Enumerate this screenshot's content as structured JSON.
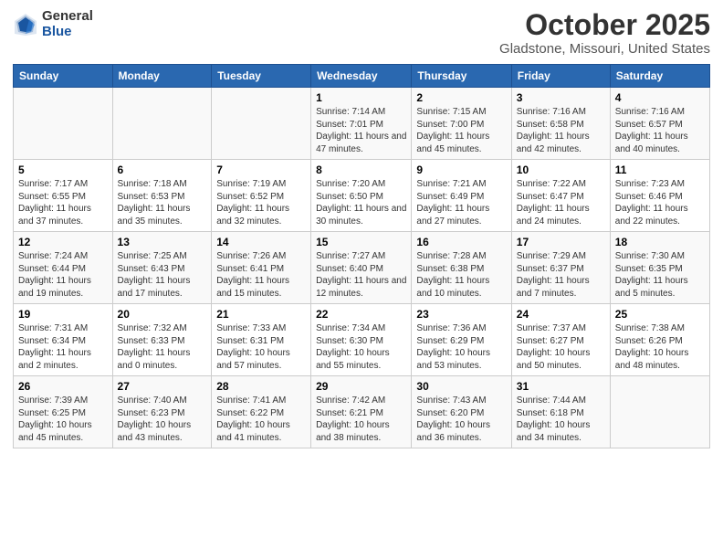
{
  "logo": {
    "general": "General",
    "blue": "Blue"
  },
  "title": "October 2025",
  "subtitle": "Gladstone, Missouri, United States",
  "days_of_week": [
    "Sunday",
    "Monday",
    "Tuesday",
    "Wednesday",
    "Thursday",
    "Friday",
    "Saturday"
  ],
  "weeks": [
    [
      {
        "day": "",
        "info": ""
      },
      {
        "day": "",
        "info": ""
      },
      {
        "day": "",
        "info": ""
      },
      {
        "day": "1",
        "info": "Sunrise: 7:14 AM\nSunset: 7:01 PM\nDaylight: 11 hours\nand 47 minutes."
      },
      {
        "day": "2",
        "info": "Sunrise: 7:15 AM\nSunset: 7:00 PM\nDaylight: 11 hours\nand 45 minutes."
      },
      {
        "day": "3",
        "info": "Sunrise: 7:16 AM\nSunset: 6:58 PM\nDaylight: 11 hours\nand 42 minutes."
      },
      {
        "day": "4",
        "info": "Sunrise: 7:16 AM\nSunset: 6:57 PM\nDaylight: 11 hours\nand 40 minutes."
      }
    ],
    [
      {
        "day": "5",
        "info": "Sunrise: 7:17 AM\nSunset: 6:55 PM\nDaylight: 11 hours\nand 37 minutes."
      },
      {
        "day": "6",
        "info": "Sunrise: 7:18 AM\nSunset: 6:53 PM\nDaylight: 11 hours\nand 35 minutes."
      },
      {
        "day": "7",
        "info": "Sunrise: 7:19 AM\nSunset: 6:52 PM\nDaylight: 11 hours\nand 32 minutes."
      },
      {
        "day": "8",
        "info": "Sunrise: 7:20 AM\nSunset: 6:50 PM\nDaylight: 11 hours\nand 30 minutes."
      },
      {
        "day": "9",
        "info": "Sunrise: 7:21 AM\nSunset: 6:49 PM\nDaylight: 11 hours\nand 27 minutes."
      },
      {
        "day": "10",
        "info": "Sunrise: 7:22 AM\nSunset: 6:47 PM\nDaylight: 11 hours\nand 24 minutes."
      },
      {
        "day": "11",
        "info": "Sunrise: 7:23 AM\nSunset: 6:46 PM\nDaylight: 11 hours\nand 22 minutes."
      }
    ],
    [
      {
        "day": "12",
        "info": "Sunrise: 7:24 AM\nSunset: 6:44 PM\nDaylight: 11 hours\nand 19 minutes."
      },
      {
        "day": "13",
        "info": "Sunrise: 7:25 AM\nSunset: 6:43 PM\nDaylight: 11 hours\nand 17 minutes."
      },
      {
        "day": "14",
        "info": "Sunrise: 7:26 AM\nSunset: 6:41 PM\nDaylight: 11 hours\nand 15 minutes."
      },
      {
        "day": "15",
        "info": "Sunrise: 7:27 AM\nSunset: 6:40 PM\nDaylight: 11 hours\nand 12 minutes."
      },
      {
        "day": "16",
        "info": "Sunrise: 7:28 AM\nSunset: 6:38 PM\nDaylight: 11 hours\nand 10 minutes."
      },
      {
        "day": "17",
        "info": "Sunrise: 7:29 AM\nSunset: 6:37 PM\nDaylight: 11 hours\nand 7 minutes."
      },
      {
        "day": "18",
        "info": "Sunrise: 7:30 AM\nSunset: 6:35 PM\nDaylight: 11 hours\nand 5 minutes."
      }
    ],
    [
      {
        "day": "19",
        "info": "Sunrise: 7:31 AM\nSunset: 6:34 PM\nDaylight: 11 hours\nand 2 minutes."
      },
      {
        "day": "20",
        "info": "Sunrise: 7:32 AM\nSunset: 6:33 PM\nDaylight: 11 hours\nand 0 minutes."
      },
      {
        "day": "21",
        "info": "Sunrise: 7:33 AM\nSunset: 6:31 PM\nDaylight: 10 hours\nand 57 minutes."
      },
      {
        "day": "22",
        "info": "Sunrise: 7:34 AM\nSunset: 6:30 PM\nDaylight: 10 hours\nand 55 minutes."
      },
      {
        "day": "23",
        "info": "Sunrise: 7:36 AM\nSunset: 6:29 PM\nDaylight: 10 hours\nand 53 minutes."
      },
      {
        "day": "24",
        "info": "Sunrise: 7:37 AM\nSunset: 6:27 PM\nDaylight: 10 hours\nand 50 minutes."
      },
      {
        "day": "25",
        "info": "Sunrise: 7:38 AM\nSunset: 6:26 PM\nDaylight: 10 hours\nand 48 minutes."
      }
    ],
    [
      {
        "day": "26",
        "info": "Sunrise: 7:39 AM\nSunset: 6:25 PM\nDaylight: 10 hours\nand 45 minutes."
      },
      {
        "day": "27",
        "info": "Sunrise: 7:40 AM\nSunset: 6:23 PM\nDaylight: 10 hours\nand 43 minutes."
      },
      {
        "day": "28",
        "info": "Sunrise: 7:41 AM\nSunset: 6:22 PM\nDaylight: 10 hours\nand 41 minutes."
      },
      {
        "day": "29",
        "info": "Sunrise: 7:42 AM\nSunset: 6:21 PM\nDaylight: 10 hours\nand 38 minutes."
      },
      {
        "day": "30",
        "info": "Sunrise: 7:43 AM\nSunset: 6:20 PM\nDaylight: 10 hours\nand 36 minutes."
      },
      {
        "day": "31",
        "info": "Sunrise: 7:44 AM\nSunset: 6:18 PM\nDaylight: 10 hours\nand 34 minutes."
      },
      {
        "day": "",
        "info": ""
      }
    ]
  ]
}
